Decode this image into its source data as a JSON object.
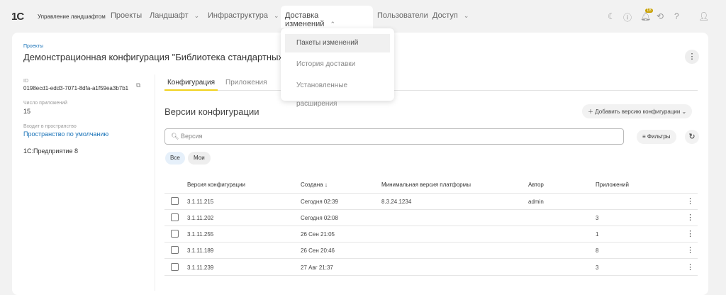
{
  "header": {
    "logo": "1C",
    "brand": "Управление ландшафтом",
    "nav": [
      {
        "label": "Проекты"
      },
      {
        "label": "Ландшафт"
      },
      {
        "label": "Инфраструктура"
      },
      {
        "label": "Доставка изменений"
      },
      {
        "label": "Пользователи"
      },
      {
        "label": "Доступ"
      }
    ],
    "notification_count": "18"
  },
  "dropdown": {
    "items": [
      "Пакеты изменений",
      "История доставки",
      "Установленные расширения"
    ]
  },
  "page": {
    "breadcrumb": "Проекты",
    "title": "Демонстрационная конфигурация \"Библиотека стандартных под"
  },
  "sidebar": {
    "id_label": "ID",
    "id_value": "0198ecd1-edd3-7071-8dfa-a1f59ea3b7b1",
    "apps_label": "Число приложений",
    "apps_value": "15",
    "space_label": "Входит в пространство",
    "space_value": "Пространство по умолчанию",
    "platform": "1С:Предприятие 8"
  },
  "tabs": [
    "Конфигурация",
    "Приложения"
  ],
  "section": {
    "title": "Версии конфигурации",
    "add_button": "Добавить версию конфигурации",
    "search_placeholder": "Версия",
    "filters": "Фильтры",
    "chips": [
      "Все",
      "Мои"
    ]
  },
  "table": {
    "headers": [
      "Версия конфигурации",
      "Создана ↓",
      "Минимальная версия платформы",
      "Автор",
      "Приложений"
    ],
    "rows": [
      [
        "3.1.11.215",
        "Сегодня 02:39",
        "8.3.24.1234",
        "admin",
        ""
      ],
      [
        "3.1.11.202",
        "Сегодня 02:08",
        "",
        "",
        "3"
      ],
      [
        "3.1.11.255",
        "26 Сен 21:05",
        "",
        "",
        "1"
      ],
      [
        "3.1.11.189",
        "26 Сен 20:46",
        "",
        "",
        "8"
      ],
      [
        "3.1.11.239",
        "27 Авг 21:37",
        "",
        "",
        "3"
      ]
    ]
  }
}
